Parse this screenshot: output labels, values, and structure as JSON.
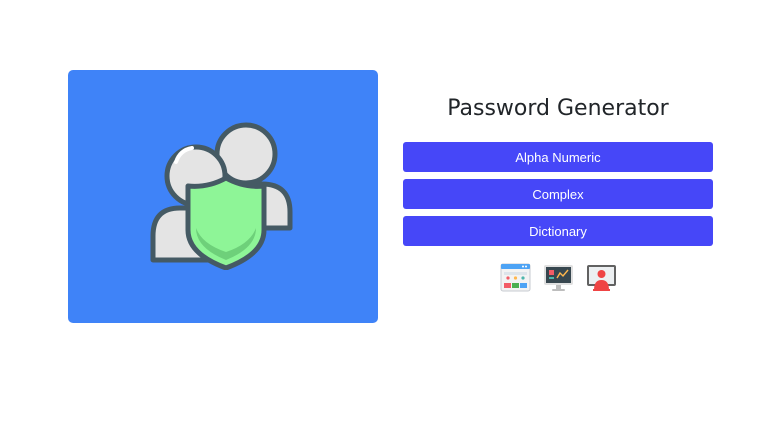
{
  "main": {
    "title": "Password Generator"
  },
  "buttons": {
    "alpha_numeric": "Alpha Numeric",
    "complex": "Complex",
    "dictionary": "Dictionary"
  },
  "icons": {
    "hero": "users-shield-icon",
    "row": [
      "browser-window-icon",
      "monitor-chart-icon",
      "user-monitor-icon"
    ]
  },
  "colors": {
    "card": "#3f83f8",
    "button": "#4647f8",
    "shield": "#8ef597"
  }
}
